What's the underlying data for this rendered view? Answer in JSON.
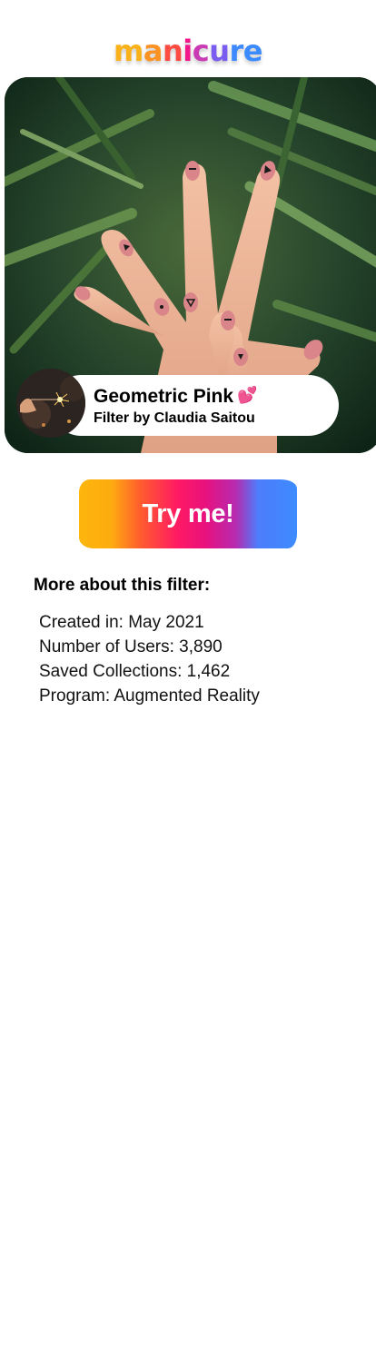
{
  "brand": {
    "logo_text": "manicure",
    "logo_colors": [
      "#fbb11a",
      "#fb9224",
      "#ff4c43",
      "#f2178a",
      "#c93ab4",
      "#7a5cf0",
      "#3e8afc",
      "#3a8bff"
    ]
  },
  "filter": {
    "name": "Geometric Pink",
    "name_icon": "two-hearts-icon",
    "name_emoji": "💕",
    "author": "Filter by Claudia Saitou"
  },
  "cta": {
    "label": "Try me!"
  },
  "details": {
    "title": "More about this filter:",
    "items": [
      "Created in: May 2021",
      "Number of Users: 3,890",
      "Saved Collections: 1,462",
      "Program: Augmented Reality"
    ]
  }
}
